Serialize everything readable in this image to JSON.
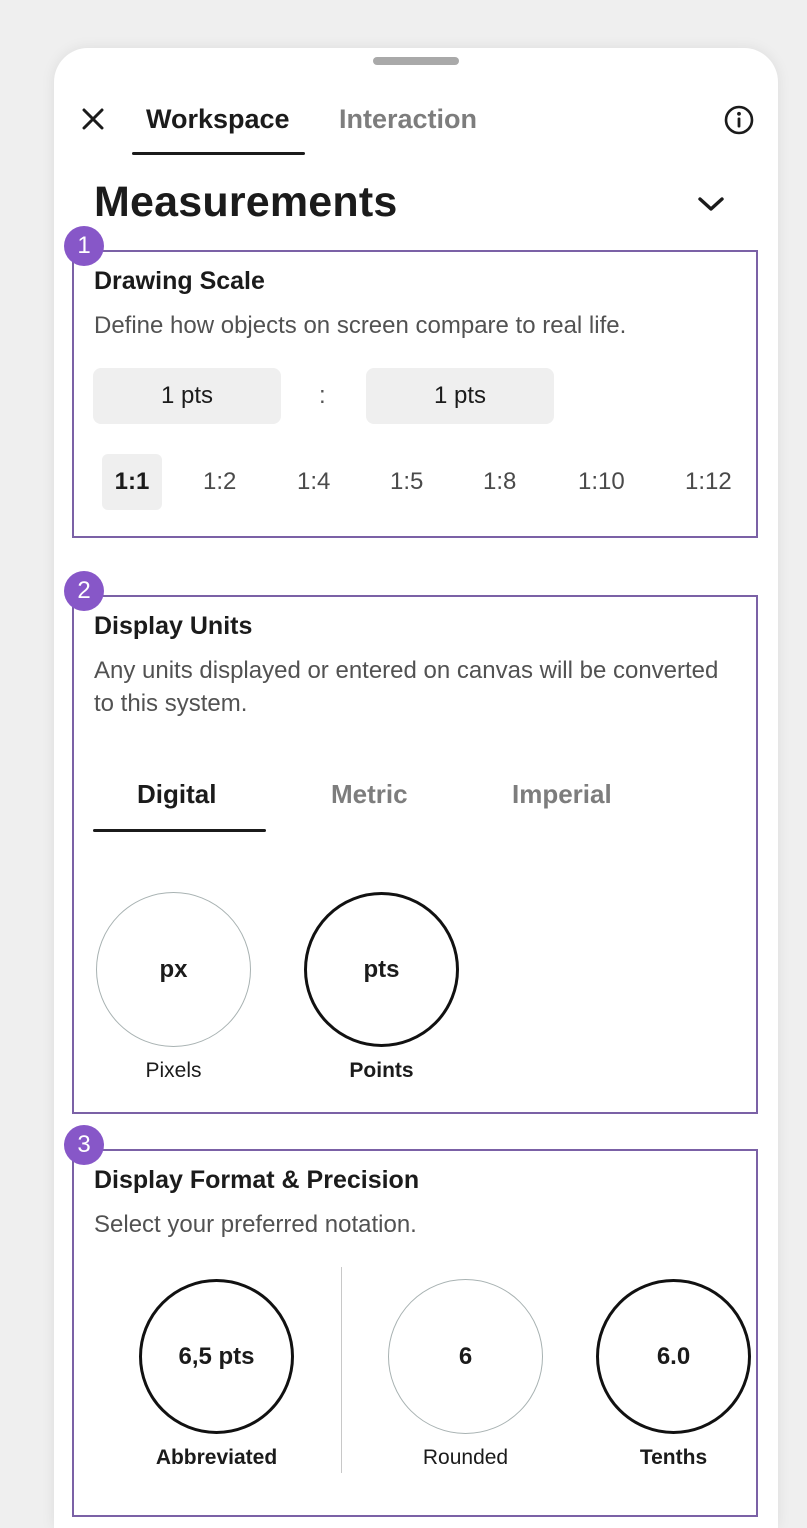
{
  "header": {
    "close_icon": "close-icon",
    "tabs": [
      {
        "label": "Workspace",
        "active": true
      },
      {
        "label": "Interaction",
        "active": false
      }
    ],
    "info_icon": "info-icon"
  },
  "page": {
    "title": "Measurements",
    "collapse_icon": "chevron-down-icon"
  },
  "drawing_scale": {
    "badge": "1",
    "title": "Drawing Scale",
    "description": "Define how objects on screen compare to real life.",
    "left_value": "1 pts",
    "separator": ":",
    "right_value": "1 pts",
    "presets": [
      "1:1",
      "1:2",
      "1:4",
      "1:5",
      "1:8",
      "1:10",
      "1:12"
    ],
    "selected_preset": "1:1"
  },
  "display_units": {
    "badge": "2",
    "title": "Display Units",
    "description": "Any units displayed or entered on canvas will be converted to this system.",
    "tabs": [
      {
        "label": "Digital",
        "active": true
      },
      {
        "label": "Metric",
        "active": false
      },
      {
        "label": "Imperial",
        "active": false
      }
    ],
    "options": [
      {
        "abbr": "px",
        "label": "Pixels",
        "selected": false
      },
      {
        "abbr": "pts",
        "label": "Points",
        "selected": true
      }
    ]
  },
  "display_format": {
    "badge": "3",
    "title": "Display Format & Precision",
    "description": "Select your preferred notation.",
    "notation": {
      "sample": "6,5 pts",
      "label": "Abbreviated",
      "selected": true
    },
    "precision": [
      {
        "sample": "6",
        "label": "Rounded",
        "selected": false
      },
      {
        "sample": "6.0",
        "label": "Tenths",
        "selected": true
      }
    ]
  },
  "colors": {
    "accent": "#8757c8",
    "section_border": "#7b61a6",
    "text": "#1b1b1b",
    "muted": "#7d7d7d"
  }
}
